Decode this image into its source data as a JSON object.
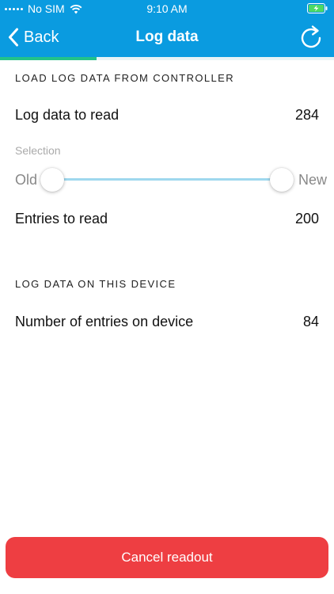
{
  "status_bar": {
    "carrier": "No SIM",
    "time": "9:10 AM"
  },
  "nav": {
    "back_label": "Back",
    "title": "Log data",
    "back_icon": "chevron-left-icon",
    "refresh_icon": "refresh-icon"
  },
  "progress": {
    "fraction": 0.29
  },
  "controller_section": {
    "header": "LOAD LOG DATA FROM CONTROLLER",
    "log_data_label": "Log data to read",
    "log_data_value": "284",
    "selection_label": "Selection",
    "slider": {
      "min_label": "Old",
      "max_label": "New",
      "low_fraction": 0.0,
      "high_fraction": 1.0
    },
    "entries_label": "Entries to read",
    "entries_value": "200"
  },
  "device_section": {
    "header": "LOG DATA ON THIS DEVICE",
    "entries_label": "Number of entries on device",
    "entries_value": "84"
  },
  "cancel_button": {
    "label": "Cancel readout"
  },
  "colors": {
    "nav_background": "#0a9be0",
    "progress_fill": "#22c38a",
    "slider_track": "#9fd8ee",
    "cancel_button": "#ee3e42"
  }
}
